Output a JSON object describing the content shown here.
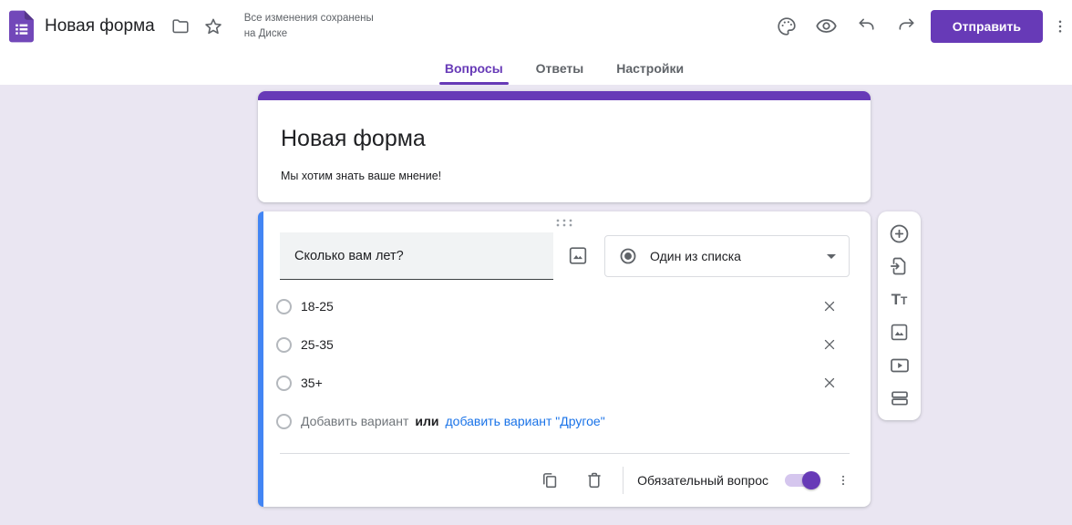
{
  "header": {
    "app_title": "Новая форма",
    "save_status": "Все изменения сохранены\nна Диске",
    "send_button": "Отправить"
  },
  "tabs": {
    "questions": "Вопросы",
    "answers": "Ответы",
    "settings": "Настройки"
  },
  "form": {
    "title": "Новая форма",
    "description": "Мы хотим знать ваше мнение!"
  },
  "question": {
    "text": "Сколько вам лет?",
    "type": "Один из списка",
    "options": [
      {
        "label": "18-25"
      },
      {
        "label": "25-35"
      },
      {
        "label": "35+"
      }
    ],
    "add_option": "Добавить вариант",
    "or": "или",
    "add_other": "добавить вариант \"Другое\"",
    "required_label": "Обязательный вопрос"
  },
  "icons": {
    "forms-logo": "purple-document-with-list",
    "folder": "move-to-folder",
    "star": "star-outline",
    "palette": "customize-theme",
    "eye": "preview",
    "undo": "undo-arrow",
    "redo": "redo-arrow",
    "more": "vertical-dots-menu",
    "drag": "drag-handle-dots",
    "image": "insert-image",
    "radio-checked": "radio-button-checked",
    "caret": "dropdown-arrow",
    "remove": "x-close",
    "duplicate": "copy",
    "delete": "trash",
    "add-question": "plus-circle",
    "import-questions": "document-with-arrow",
    "add-title": "Tt",
    "add-video": "play-rectangle",
    "add-section": "stacked-bars"
  },
  "colors": {
    "accent_purple": "#673ab7",
    "canvas_background": "#eae6f2",
    "question_active_border": "#4285f4",
    "link_blue": "#1a73e8",
    "icon_gray": "#5f6368",
    "toggle_track": "#d5c6ee"
  }
}
